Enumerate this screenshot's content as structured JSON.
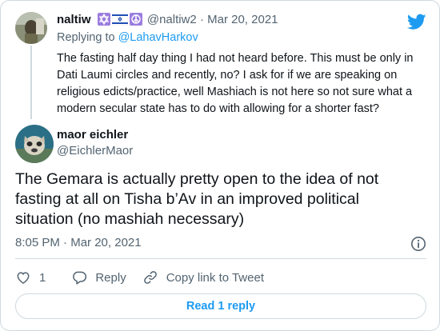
{
  "parent_tweet": {
    "author_name": "naltiw",
    "badges": [
      "star-of-david-emoji",
      "israel-flag-emoji",
      "peace-symbol-emoji"
    ],
    "handle": "@naltiw2",
    "separator": "·",
    "date": "Mar 20, 2021",
    "replying_prefix": "Replying to",
    "replying_to": "@LahavHarkov",
    "text": "The fasting half day thing I had not heard before. This must be only in Dati Laumi circles and recently, no? I ask for if we are speaking on religious edicts/practice, well Mashiach is not here so not sure what a modern secular state has to do with allowing for a shorter fast?"
  },
  "main_tweet": {
    "author_name": "maor eichler",
    "handle": "@EichlerMaor",
    "text": "The Gemara is actually pretty open to the idea of not fasting at all on Tisha b’Av in an improved political situation (no mashiah necessary)",
    "time": "8:05 PM",
    "separator": "·",
    "date": "Mar 20, 2021"
  },
  "actions": {
    "like_count": "1",
    "reply_label": "Reply",
    "copy_link_label": "Copy link to Tweet"
  },
  "read_replies_label": "Read 1 reply",
  "colors": {
    "accent": "#1d9bf0",
    "text": "#0f1419",
    "secondary": "#536471",
    "border": "#cfd9de"
  }
}
